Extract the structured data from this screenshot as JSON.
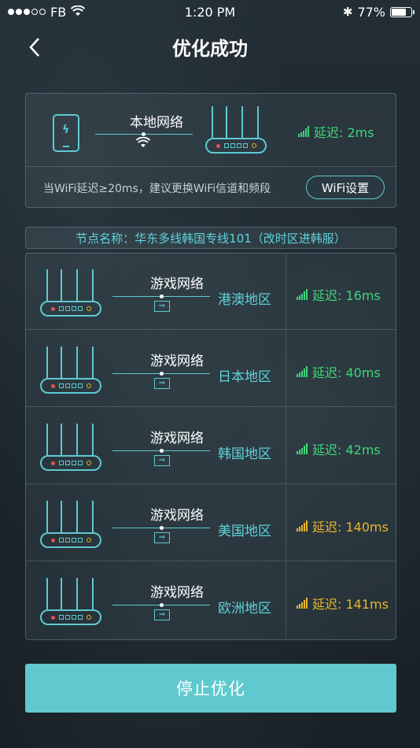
{
  "status_bar": {
    "carrier": "FB",
    "time": "1:20 PM",
    "battery": "77%",
    "battery_level": 0.77
  },
  "nav": {
    "back_icon": "chevron-left-icon",
    "title": "优化成功"
  },
  "local": {
    "label": "本地网络",
    "latency": "延迟: 2ms",
    "latency_color": "#3fd67a",
    "tip": "当WiFi延迟≥20ms，建议更换WiFi信道和频段",
    "wifi_button": "WiFi设置"
  },
  "node": {
    "name": "节点名称：华东多线韩国专线101（改时区进韩服）"
  },
  "regions": [
    {
      "game_label": "游戏网络",
      "region": "港澳地区",
      "latency": "延迟: 16ms",
      "color": "#3fd67a"
    },
    {
      "game_label": "游戏网络",
      "region": "日本地区",
      "latency": "延迟: 40ms",
      "color": "#3fd67a"
    },
    {
      "game_label": "游戏网络",
      "region": "韩国地区",
      "latency": "延迟: 42ms",
      "color": "#3fd67a"
    },
    {
      "game_label": "游戏网络",
      "region": "美国地区",
      "latency": "延迟: 140ms",
      "color": "#e7b62c"
    },
    {
      "game_label": "游戏网络",
      "region": "欧洲地区",
      "latency": "延迟: 141ms",
      "color": "#e7b62c"
    }
  ],
  "stop_button": "停止优化"
}
